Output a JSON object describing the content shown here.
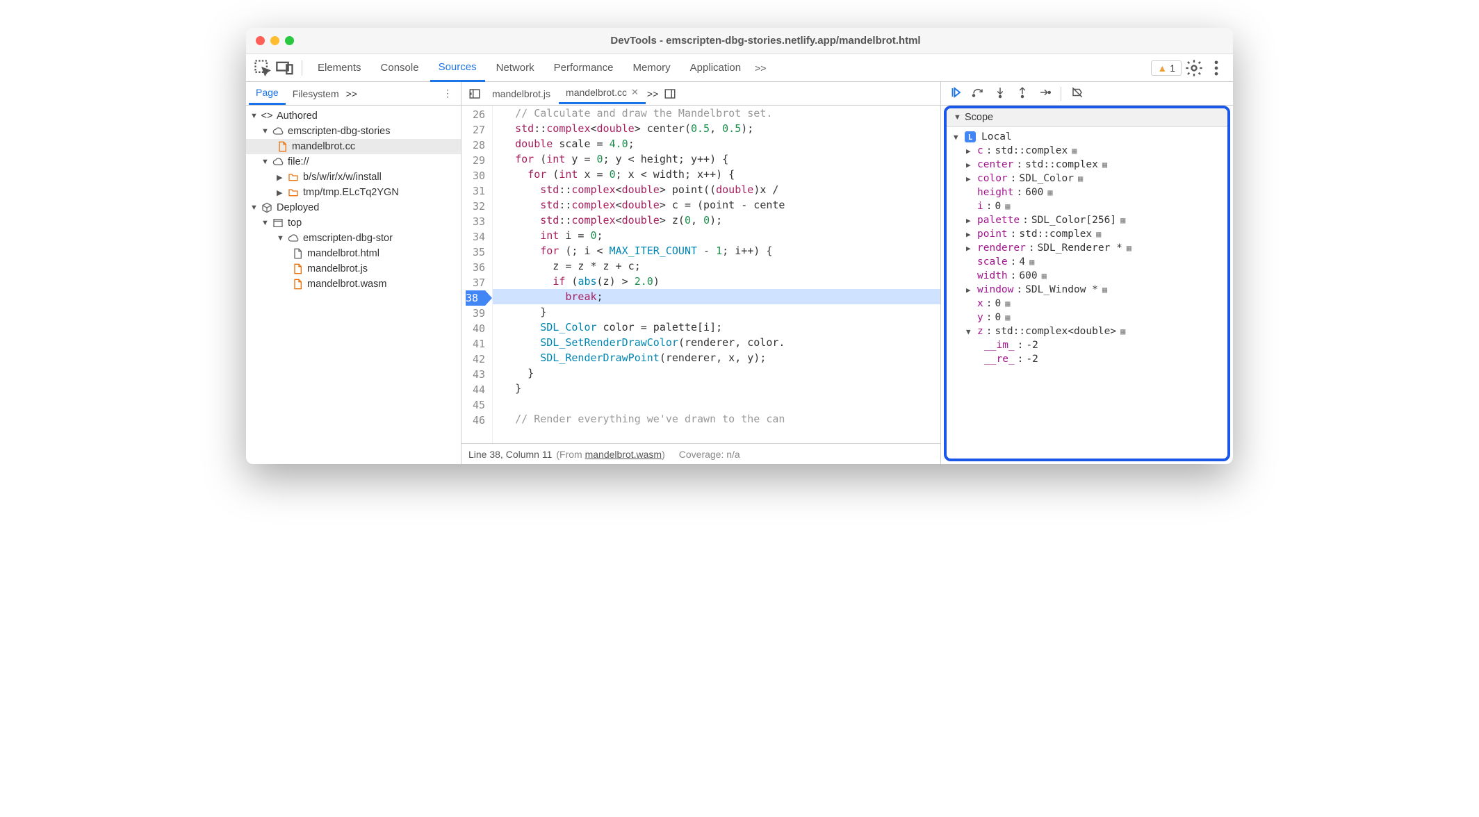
{
  "window": {
    "title": "DevTools - emscripten-dbg-stories.netlify.app/mandelbrot.html"
  },
  "main_tabs": {
    "items": [
      "Elements",
      "Console",
      "Sources",
      "Network",
      "Performance",
      "Memory",
      "Application"
    ],
    "active": "Sources",
    "overflow": ">>",
    "warn_count": "1"
  },
  "left_tabs": {
    "items": [
      "Page",
      "Filesystem"
    ],
    "active": "Page",
    "overflow": ">>"
  },
  "tree": {
    "authored": {
      "label": "Authored",
      "children": [
        {
          "label": "emscripten-dbg-stories",
          "icon": "cloud",
          "children": [
            {
              "label": "mandelbrot.cc",
              "icon": "file-orange",
              "selected": true
            }
          ]
        },
        {
          "label": "file://",
          "icon": "cloud",
          "children": [
            {
              "label": "b/s/w/ir/x/w/install",
              "icon": "folder-orange"
            },
            {
              "label": "tmp/tmp.ELcTq2YGN",
              "icon": "folder-orange"
            }
          ]
        }
      ]
    },
    "deployed": {
      "label": "Deployed",
      "children": [
        {
          "label": "top",
          "icon": "window",
          "children": [
            {
              "label": "emscripten-dbg-stor",
              "icon": "cloud",
              "children": [
                {
                  "label": "mandelbrot.html",
                  "icon": "file"
                },
                {
                  "label": "mandelbrot.js",
                  "icon": "file-orange"
                },
                {
                  "label": "mandelbrot.wasm",
                  "icon": "file-orange"
                }
              ]
            }
          ]
        }
      ]
    }
  },
  "file_tabs": {
    "items": [
      "mandelbrot.js",
      "mandelbrot.cc"
    ],
    "active": "mandelbrot.cc",
    "overflow": ">>"
  },
  "editor": {
    "first_line": 26,
    "breakpoint_line": 38,
    "lines": [
      "  // Calculate and draw the Mandelbrot set.",
      "  std::complex<double> center(0.5, 0.5);",
      "  double scale = 4.0;",
      "  for (int y = 0; y < height; y++) {",
      "    for (int x = 0; x < width; x++) {",
      "      std::complex<double> point((double)x /",
      "      std::complex<double> c = (point - cente",
      "      std::complex<double> z(0, 0);",
      "      int i = 0;",
      "      for (; i < MAX_ITER_COUNT - 1; i++) {",
      "        z = z * z + c;",
      "        if (abs(z) > 2.0)",
      "          break;",
      "      }",
      "      SDL_Color color = palette[i];",
      "      SDL_SetRenderDrawColor(renderer, color.",
      "      SDL_RenderDrawPoint(renderer, x, y);",
      "    }",
      "  }",
      "",
      "  // Render everything we've drawn to the can"
    ]
  },
  "status": {
    "pos": "Line 38, Column 11",
    "from_label": "(From ",
    "from_link": "mandelbrot.wasm",
    "from_close": ")",
    "coverage": "Coverage: n/a"
  },
  "scope": {
    "title": "Scope",
    "local_label": "Local",
    "vars": [
      {
        "name": "c",
        "val": "std::complex<double>",
        "exp": true
      },
      {
        "name": "center",
        "val": "std::complex<double>",
        "exp": true
      },
      {
        "name": "color",
        "val": "SDL_Color",
        "exp": true
      },
      {
        "name": "height",
        "val": "600"
      },
      {
        "name": "i",
        "val": "0"
      },
      {
        "name": "palette",
        "val": "SDL_Color[256]",
        "exp": true
      },
      {
        "name": "point",
        "val": "std::complex<double>",
        "exp": true
      },
      {
        "name": "renderer",
        "val": "SDL_Renderer *",
        "exp": true
      },
      {
        "name": "scale",
        "val": "4"
      },
      {
        "name": "width",
        "val": "600"
      },
      {
        "name": "window",
        "val": "SDL_Window *",
        "exp": true
      },
      {
        "name": "x",
        "val": "0"
      },
      {
        "name": "y",
        "val": "0"
      }
    ],
    "z": {
      "name": "z",
      "val": "std::complex<double>",
      "children": [
        {
          "name": "__im_",
          "val": "-2"
        },
        {
          "name": "__re_",
          "val": "-2"
        }
      ]
    }
  }
}
